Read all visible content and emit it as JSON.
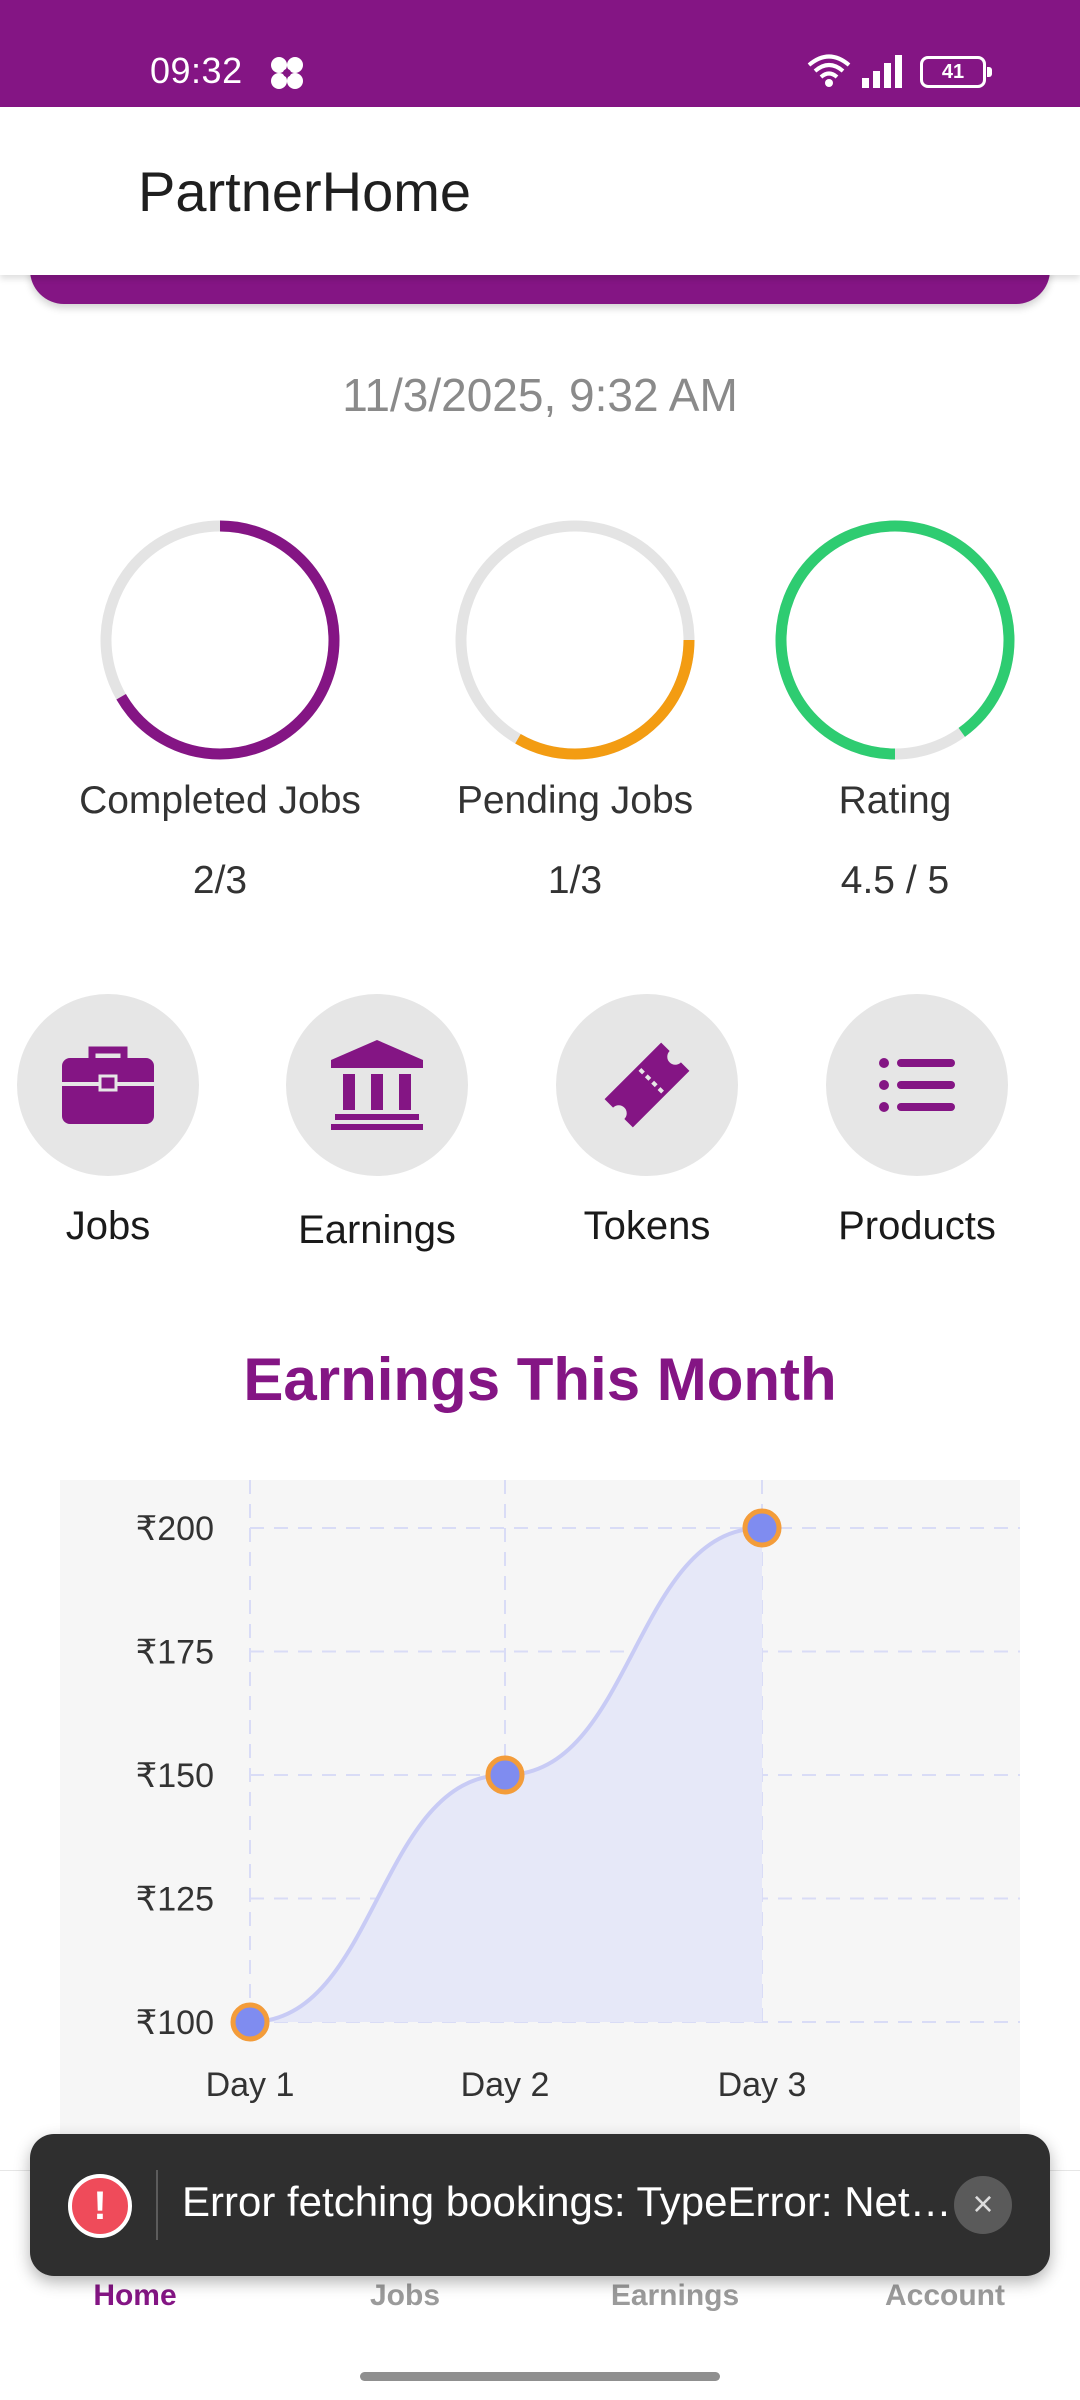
{
  "status_bar": {
    "time": "09:32",
    "battery": "41",
    "icons": [
      "fan-icon",
      "wifi-icon",
      "signal-icon",
      "battery-icon"
    ]
  },
  "header": {
    "title": "PartnerHome"
  },
  "datetime": "11/3/2025, 9:32 AM",
  "stats": [
    {
      "label": "Completed Jobs",
      "value": "2/3",
      "fraction": 0.6667,
      "color": "#841584"
    },
    {
      "label": "Pending Jobs",
      "value": "1/3",
      "fraction": 0.3333,
      "color": "#F39C12"
    },
    {
      "label": "Rating",
      "value": "4.5 / 5",
      "fraction": 0.9,
      "color": "#2ECC71"
    }
  ],
  "quick_actions": [
    {
      "label": "Jobs",
      "icon": "briefcase-icon"
    },
    {
      "label": "Earnings",
      "icon": "bank-icon"
    },
    {
      "label": "Tokens",
      "icon": "ticket-icon"
    },
    {
      "label": "Products",
      "icon": "list-icon"
    }
  ],
  "section_title": "Earnings This Month",
  "chart_data": {
    "type": "line",
    "categories": [
      "Day 1",
      "Day 2",
      "Day 3"
    ],
    "values": [
      100,
      150,
      200
    ],
    "ylim": [
      100,
      200
    ],
    "yticks": [
      100,
      125,
      150,
      175,
      200
    ],
    "ytick_labels": [
      "₹100",
      "₹125",
      "₹150",
      "₹175",
      "₹200"
    ],
    "area_fill": true,
    "grid": true,
    "line_color": "#C8CBF5",
    "point_color": "#7F8CF0",
    "point_border": "#F39C3A"
  },
  "toast": {
    "message": "Error fetching bookings: TypeError: Network request failed",
    "close": "×",
    "icon": "!"
  },
  "bottom_nav": [
    {
      "label": "Home",
      "active": true
    },
    {
      "label": "Jobs",
      "active": false
    },
    {
      "label": "Earnings",
      "active": false
    },
    {
      "label": "Account",
      "active": false
    }
  ],
  "colors": {
    "primary": "#841584",
    "toast_bg": "#2F2F2F"
  }
}
